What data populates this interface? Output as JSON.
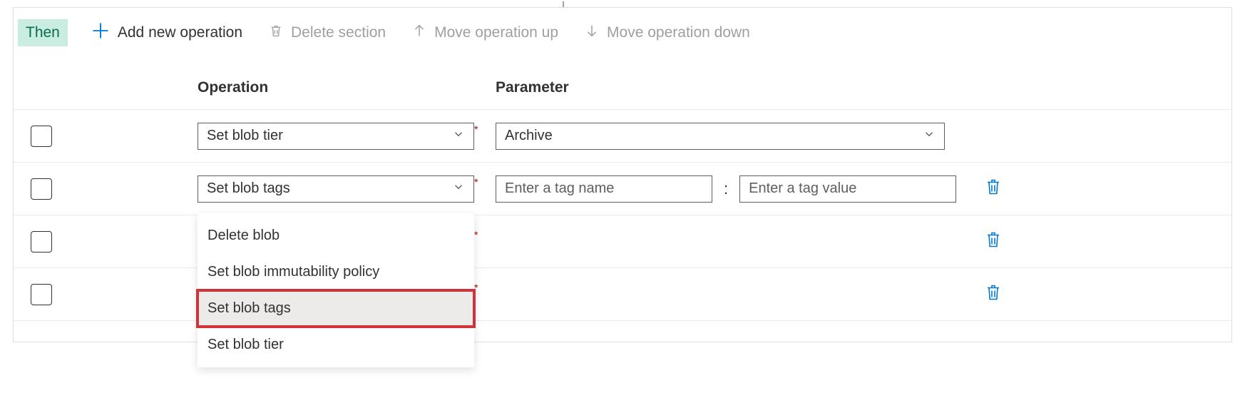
{
  "toolbar": {
    "then_label": "Then",
    "add_label": "Add new operation",
    "delete_label": "Delete section",
    "move_up_label": "Move operation up",
    "move_down_label": "Move operation down"
  },
  "headers": {
    "operation": "Operation",
    "parameter": "Parameter"
  },
  "rows": [
    {
      "operation": "Set blob tier",
      "parameter_selected": "Archive"
    },
    {
      "operation": "Set blob tags",
      "tag_name_placeholder": "Enter a tag name",
      "tag_value_placeholder": "Enter a tag value"
    },
    {
      "operation": ""
    },
    {
      "operation": ""
    }
  ],
  "dropdown": {
    "options": [
      {
        "label": "Delete blob"
      },
      {
        "label": "Set blob immutability policy"
      },
      {
        "label": "Set blob tags",
        "selected": true
      },
      {
        "label": "Set blob tier"
      }
    ]
  }
}
